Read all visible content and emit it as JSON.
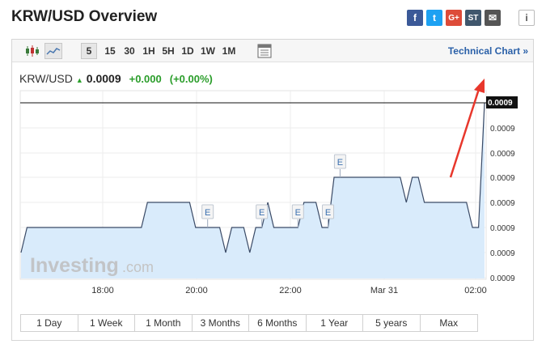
{
  "page": {
    "title": "KRW/USD Overview"
  },
  "share": [
    {
      "name": "facebook-icon",
      "glyph": "f",
      "color": "#3b5998"
    },
    {
      "name": "twitter-icon",
      "glyph": "t",
      "color": "#1da1f2"
    },
    {
      "name": "google-plus-icon",
      "glyph": "G+",
      "color": "#dd4b39"
    },
    {
      "name": "stocktwits-icon",
      "glyph": "ST",
      "color": "#40576d"
    },
    {
      "name": "email-icon",
      "glyph": "✉",
      "color": "#555555"
    },
    {
      "name": "info-icon",
      "glyph": "i",
      "color": "#555555"
    }
  ],
  "toolbar": {
    "intervals": [
      "5",
      "15",
      "30",
      "1H",
      "5H",
      "1D",
      "1W",
      "1M"
    ],
    "active_interval": "5",
    "technical_chart_label": "Technical Chart »"
  },
  "quote": {
    "symbol": "KRW/USD",
    "price": "0.0009",
    "change": "+0.000",
    "change_pct": "(+0.00%)"
  },
  "watermark": {
    "brand": "Investing",
    "suffix": ".com"
  },
  "chart_data": {
    "type": "area",
    "x_tick_labels": [
      "18:00",
      "20:00",
      "22:00",
      "Mar 31",
      "02:00"
    ],
    "y_tick_labels": [
      "0.0009",
      "0.0009",
      "0.0009",
      "0.0009",
      "0.0009",
      "0.0009",
      "0.0009",
      "0.0009"
    ],
    "current_value_label": "0.0009",
    "y_levels": [
      0,
      1,
      2,
      3,
      4
    ],
    "series": [
      {
        "values": [
          0,
          1,
          1,
          1,
          1,
          1,
          1,
          1,
          1,
          1,
          1,
          1,
          1,
          1,
          1,
          1,
          1,
          1,
          1,
          1,
          1,
          2,
          2,
          2,
          2,
          2,
          2,
          2,
          2,
          1,
          1,
          1,
          1,
          1,
          0,
          1,
          1,
          1,
          0,
          1,
          1,
          2,
          1,
          1,
          1,
          1,
          1,
          2,
          2,
          2,
          1,
          1,
          3,
          3,
          3,
          3,
          3,
          3,
          3,
          3,
          3,
          3,
          3,
          3,
          2,
          3,
          3,
          2,
          2,
          2,
          2,
          2,
          2,
          2,
          2,
          1,
          1,
          4
        ]
      }
    ],
    "event_markers": [
      {
        "label": "E",
        "index": 31
      },
      {
        "label": "E",
        "index": 40
      },
      {
        "label": "E",
        "index": 46
      },
      {
        "label": "E",
        "index": 51
      },
      {
        "label": "E",
        "index": 53
      }
    ],
    "colors": {
      "line": "#3a4a66",
      "fill": "#d9ebfb",
      "arrow": "#e8372c"
    },
    "grid": true
  },
  "range_buttons": [
    "1 Day",
    "1 Week",
    "1 Month",
    "3 Months",
    "6 Months",
    "1 Year",
    "5 years",
    "Max"
  ]
}
